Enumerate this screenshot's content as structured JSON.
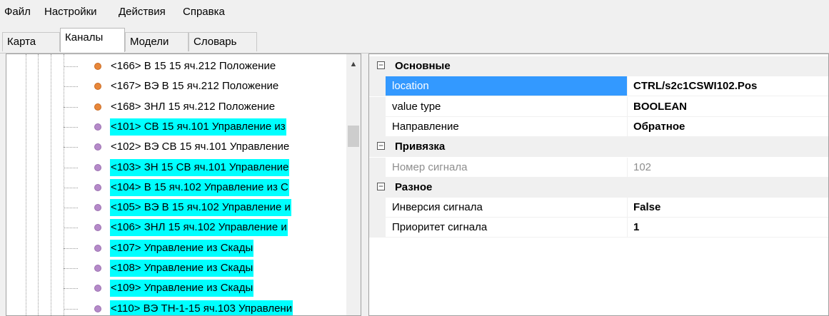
{
  "menu": [
    {
      "label": "Файл"
    },
    {
      "label": "Настройки"
    },
    {
      "label": "Действия"
    },
    {
      "label": "Справка"
    }
  ],
  "tabs": [
    {
      "label": "Карта"
    },
    {
      "label": "Каналы"
    },
    {
      "label": "Модели"
    },
    {
      "label": "Словарь"
    }
  ],
  "active_tab": "Каналы",
  "colors": {
    "orange_dot": "#e8873a",
    "purple_dot": "#b58ac9",
    "selection_cyan": "#00ffff",
    "selected_property": "#3399ff"
  },
  "tree_items": [
    {
      "label": "<166> В 15 15 яч.212 Положение",
      "icon": "orange-circle-icon",
      "highlighted": false
    },
    {
      "label": "<167> ВЭ В 15 яч.212 Положение",
      "icon": "orange-circle-icon",
      "highlighted": false
    },
    {
      "label": "<168> ЗНЛ 15 яч.212 Положение",
      "icon": "orange-circle-icon",
      "highlighted": false
    },
    {
      "label": "<101> СВ 15 яч.101 Управление из",
      "icon": "purple-circle-icon",
      "highlighted": true
    },
    {
      "label": "<102> ВЭ СВ 15 яч.101 Управление",
      "icon": "purple-circle-icon",
      "highlighted": false
    },
    {
      "label": "<103> ЗН 15 СВ яч.101 Управление",
      "icon": "purple-circle-icon",
      "highlighted": true
    },
    {
      "label": "<104> В 15 яч.102 Управление из С",
      "icon": "purple-circle-icon",
      "highlighted": true
    },
    {
      "label": "<105> ВЭ В 15 яч.102 Управление и",
      "icon": "purple-circle-icon",
      "highlighted": true
    },
    {
      "label": "<106> ЗНЛ 15 яч.102 Управление и",
      "icon": "purple-circle-icon",
      "highlighted": true
    },
    {
      "label": "<107> Управление из Скады",
      "icon": "purple-circle-icon",
      "highlighted": true
    },
    {
      "label": "<108> Управление из Скады",
      "icon": "purple-circle-icon",
      "highlighted": true
    },
    {
      "label": "<109> Управление из Скады",
      "icon": "purple-circle-icon",
      "highlighted": true
    },
    {
      "label": "<110> ВЭ ТН-1-15 яч.103 Управлени",
      "icon": "purple-circle-icon",
      "highlighted": true
    }
  ],
  "properties": [
    {
      "category": "Основные",
      "expander": "⊟",
      "rows": [
        {
          "name": "location",
          "value": "CTRL/s2c1CSWI102.Pos",
          "selected": true,
          "disabled": false
        },
        {
          "name": "value type",
          "value": "BOOLEAN",
          "selected": false,
          "disabled": false
        },
        {
          "name": "Направление",
          "value": "Обратное",
          "selected": false,
          "disabled": false
        }
      ]
    },
    {
      "category": "Привязка",
      "expander": "⊟",
      "rows": [
        {
          "name": "Номер сигнала",
          "value": "102",
          "selected": false,
          "disabled": true
        }
      ]
    },
    {
      "category": "Разное",
      "expander": "⊟",
      "rows": [
        {
          "name": "Инверсия сигнала",
          "value": "False",
          "selected": false,
          "disabled": false
        },
        {
          "name": "Приоритет сигнала",
          "value": "1",
          "selected": false,
          "disabled": false
        }
      ]
    }
  ]
}
